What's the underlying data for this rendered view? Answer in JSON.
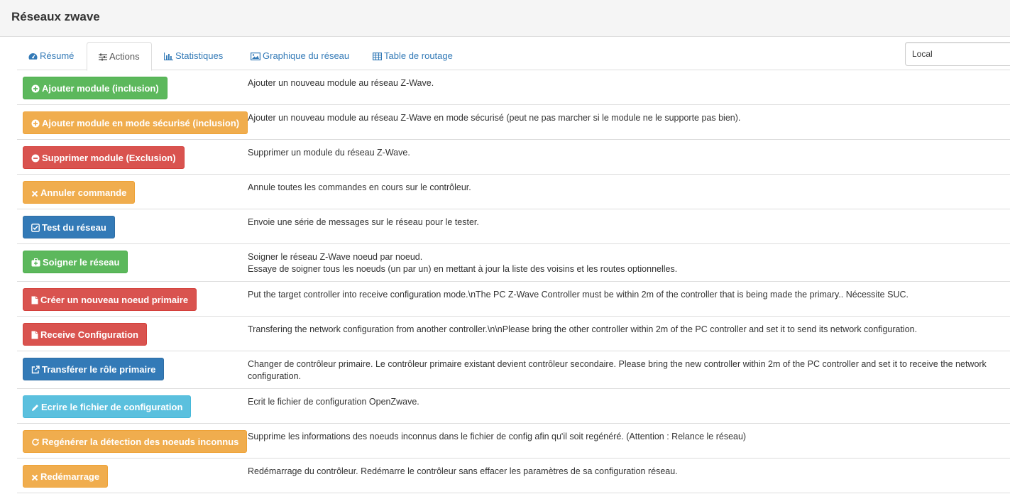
{
  "header": {
    "title": "Réseaux zwave"
  },
  "tabs": [
    {
      "label": "Résumé",
      "icon": "dashboard-icon"
    },
    {
      "label": "Actions",
      "icon": "sliders-icon",
      "active": true
    },
    {
      "label": "Statistiques",
      "icon": "bar-chart-icon"
    },
    {
      "label": "Graphique du réseau",
      "icon": "picture-icon"
    },
    {
      "label": "Table de routage",
      "icon": "table-icon"
    }
  ],
  "controller_select": {
    "value": "Local"
  },
  "actions": [
    {
      "button": "Ajouter module (inclusion)",
      "style": "success",
      "icon": "plus-circle-icon",
      "description": "Ajouter un nouveau module au réseau Z-Wave."
    },
    {
      "button": "Ajouter module en mode sécurisé (inclusion)",
      "style": "warning",
      "icon": "plus-circle-icon",
      "description": "Ajouter un nouveau module au réseau Z-Wave en mode sécurisé (peut ne pas marcher si le module ne le supporte pas bien)."
    },
    {
      "button": "Supprimer module (Exclusion)",
      "style": "danger",
      "icon": "minus-circle-icon",
      "description": "Supprimer un module du réseau Z-Wave."
    },
    {
      "button": "Annuler commande",
      "style": "warning",
      "icon": "times-icon",
      "description": "Annule toutes les commandes en cours sur le contrôleur."
    },
    {
      "button": "Test du réseau",
      "style": "primary",
      "icon": "check-square-icon",
      "description": "Envoie une série de messages sur le réseau pour le tester."
    },
    {
      "button": "Soigner le réseau",
      "style": "success",
      "icon": "medkit-icon",
      "description": "Soigner le réseau Z-Wave noeud par noeud.",
      "description2": "Essaye de soigner tous les noeuds (un par un) en mettant à jour la liste des voisins et les routes optionnelles."
    },
    {
      "button": "Créer un nouveau noeud primaire",
      "style": "danger",
      "icon": "file-icon",
      "description": "Put the target controller into receive configuration mode.\\nThe PC Z-Wave Controller must be within 2m of the controller that is being made the primary.. Nécessite SUC."
    },
    {
      "button": "Receive Configuration",
      "style": "danger",
      "icon": "file-icon",
      "description": "Transfering the network configuration from another controller.\\n\\nPlease bring the other controller within 2m of the PC controller and set it to send its network configuration."
    },
    {
      "button": "Transférer le rôle primaire",
      "style": "primary",
      "icon": "external-link-icon",
      "description": "Changer de contrôleur primaire. Le contrôleur primaire existant devient contrôleur secondaire. Please bring the new controller within 2m of the PC controller and set it to receive the network configuration."
    },
    {
      "button": "Ecrire le fichier de configuration",
      "style": "info",
      "icon": "pencil-icon",
      "description": "Ecrit le fichier de configuration OpenZwave."
    },
    {
      "button": "Regénérer la détection des noeuds inconnus",
      "style": "warning",
      "icon": "refresh-icon",
      "description": "Supprime les informations des noeuds inconnus dans le fichier de config afin qu'il soit regénéré. (Attention : Relance le réseau)"
    },
    {
      "button": "Redémarrage",
      "style": "warning",
      "icon": "times-icon",
      "description": "Redémarrage du contrôleur. Redémarre le contrôleur sans effacer les paramètres de sa configuration réseau."
    }
  ]
}
